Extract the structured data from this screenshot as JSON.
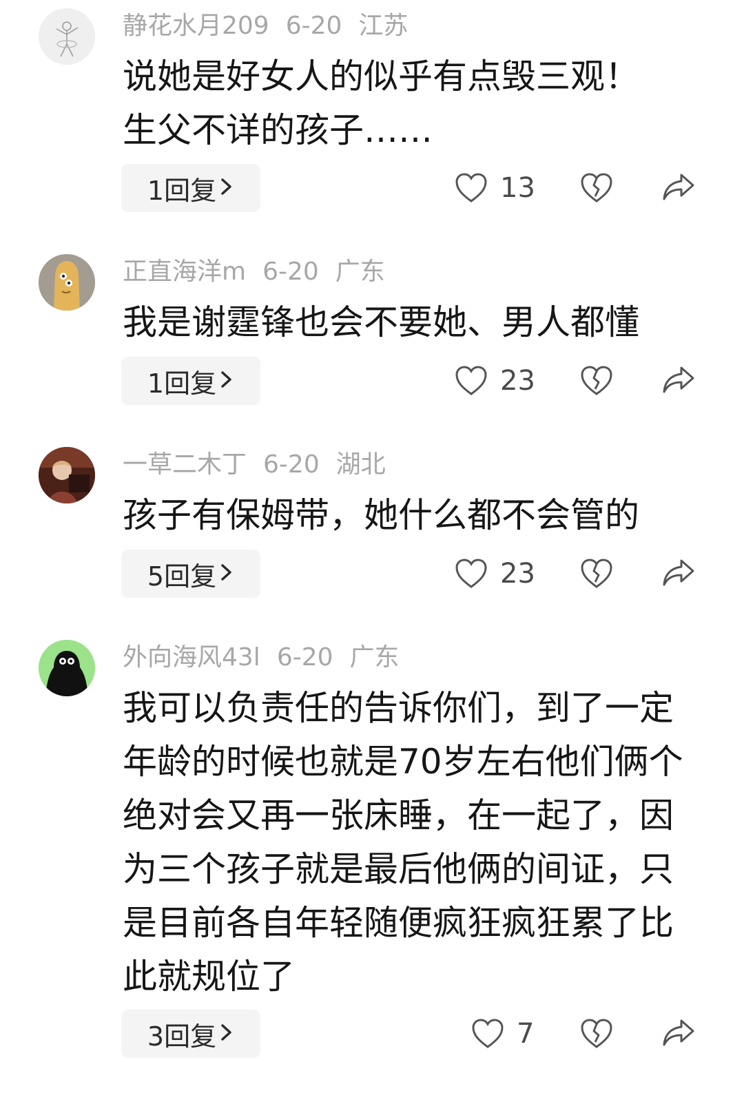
{
  "comments": [
    {
      "username": "静花水月209",
      "date": "6-20",
      "location": "江苏",
      "text": "说她是好女人的似乎有点毁三观！\n生父不详的孩子……",
      "reply_label": "1回复",
      "likes": "13",
      "avatar_icon": "ballerina-sketch-avatar"
    },
    {
      "username": "正直海洋m",
      "date": "6-20",
      "location": "广东",
      "text": "我是谢霆锋也会不要她、男人都懂",
      "reply_label": "1回复",
      "likes": "23",
      "avatar_icon": "cartoon-creature-avatar"
    },
    {
      "username": "一草二木丁",
      "date": "6-20",
      "location": "湖北",
      "text": "孩子有保姆带，她什么都不会管的",
      "reply_label": "5回复",
      "likes": "23",
      "avatar_icon": "photo-avatar"
    },
    {
      "username": "外向海风43l",
      "date": "6-20",
      "location": "广东",
      "text": "我可以负责任的告诉你们，到了一定年龄的时候也就是70岁左右他们俩个绝对会又再一张床睡，在一起了，因为三个孩子就是最后他俩的间证，只是目前各自年轻随便疯狂疯狂累了比此就规位了",
      "reply_label": "3回复",
      "likes": "7",
      "avatar_icon": "black-bird-avatar"
    }
  ],
  "icons": {
    "like": "heart-outline-icon",
    "dislike": "broken-heart-icon",
    "share": "share-arrow-icon",
    "reply_chevron": "chevron-right-icon"
  },
  "colors": {
    "meta_text": "#a7a7a7",
    "body_text": "#161616",
    "reply_button_bg": "#f4f4f4",
    "icon_stroke": "#555555"
  }
}
